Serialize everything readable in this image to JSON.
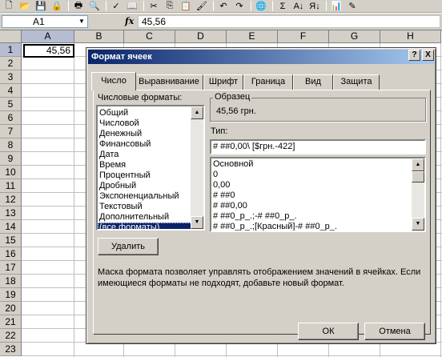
{
  "toolbar": {
    "icons": [
      "new-icon",
      "open-icon",
      "save-icon",
      "permission-icon",
      "print-icon",
      "print-preview-icon",
      "spelling-icon",
      "research-icon",
      "cut-icon",
      "copy-icon",
      "paste-icon",
      "format-painter-icon",
      "undo-icon",
      "redo-icon",
      "hyperlink-icon",
      "autosum-icon",
      "sort-ascending-icon",
      "sort-descending-icon",
      "chart-wizard-icon",
      "drawing-icon"
    ],
    "glyphs": [
      "🗋",
      "📂",
      "💾",
      "🔒",
      "🖶",
      "🔍",
      "✓",
      "📖",
      "✂",
      "⎘",
      "📋",
      "🖌",
      "↶",
      "↷",
      "🌐",
      "Σ",
      "A↓",
      "Я↓",
      "📊",
      "✎"
    ]
  },
  "formula_bar": {
    "name_box": "A1",
    "fx": "fx",
    "formula": "45,56"
  },
  "grid": {
    "columns": [
      "A",
      "B",
      "C",
      "D",
      "E",
      "F",
      "G",
      "H"
    ],
    "rows": [
      "1",
      "2",
      "3",
      "4",
      "5",
      "6",
      "7",
      "8",
      "9",
      "10",
      "11",
      "12",
      "13",
      "14",
      "15",
      "16",
      "17",
      "18",
      "19",
      "20",
      "21",
      "22",
      "23"
    ],
    "selected_cell_value": "45,56"
  },
  "dialog": {
    "title": "Формат ячеек",
    "help_button": "?",
    "close_button": "X",
    "tabs": [
      "Число",
      "Выравнивание",
      "Шрифт",
      "Граница",
      "Вид",
      "Защита"
    ],
    "active_tab": "Число",
    "number_formats_label": "Числовые форматы:",
    "number_formats": [
      "Общий",
      "Числовой",
      "Денежный",
      "Финансовый",
      "Дата",
      "Время",
      "Процентный",
      "Дробный",
      "Экспоненциальный",
      "Текстовый",
      "Дополнительный",
      "(все форматы)"
    ],
    "selected_format": "(все форматы)",
    "sample_label": "Образец",
    "sample_value": "45,56 грн.",
    "type_label": "Тип:",
    "type_value": "# ##0,00\\ [$грн.-422]",
    "type_list": [
      "Основной",
      "0",
      "0,00",
      "# ##0",
      "# ##0,00",
      "# ##0_р_.;-# ##0_р_.",
      "# ##0_р_.;[Красный]-# ##0_р_."
    ],
    "delete_button": "Удалить",
    "description": "Маска формата позволяет управлять отображением значений в ячейках. Если имеющиеся форматы не подходят, добавьте новый формат.",
    "ok_button": "ОК",
    "cancel_button": "Отмена"
  }
}
